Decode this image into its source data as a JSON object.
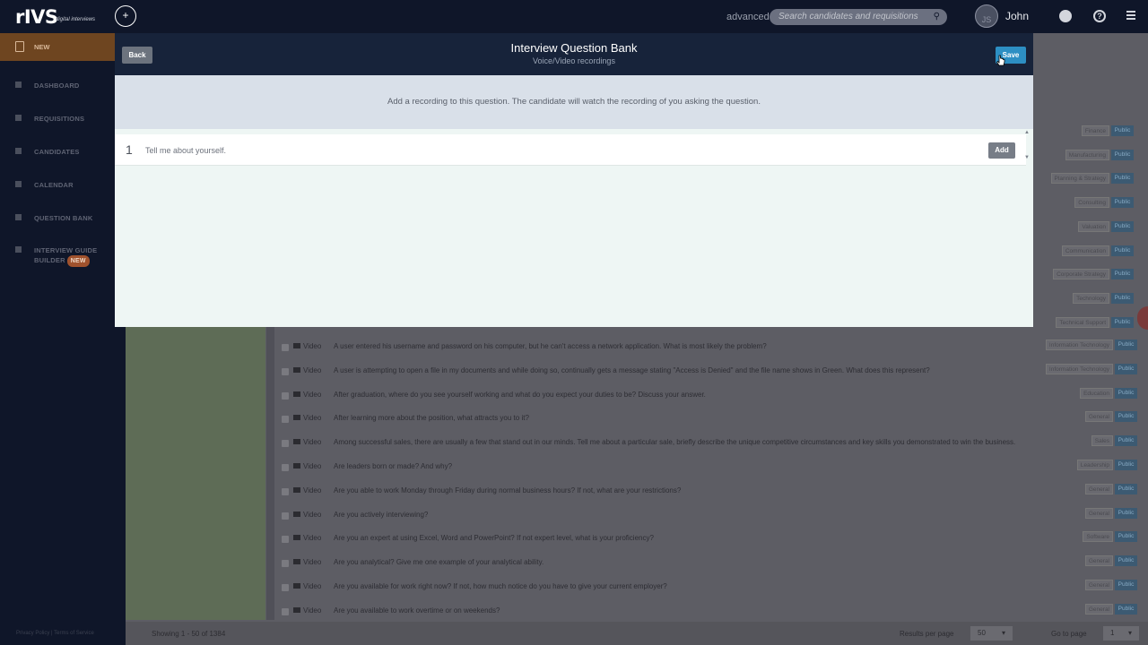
{
  "app": {
    "logo_text": "rIVS",
    "logo_sub": "digital interviews",
    "advanced_label": "advanced",
    "search_placeholder": "Search candidates and requisitions",
    "avatar_initials": "JS",
    "user_name": "John"
  },
  "sidebar": {
    "new_label": "NEW",
    "items": [
      {
        "label": "DASHBOARD"
      },
      {
        "label": "REQUISITIONS"
      },
      {
        "label": "CANDIDATES"
      },
      {
        "label": "CALENDAR"
      },
      {
        "label": "QUESTION BANK"
      },
      {
        "label": "INTERVIEW GUIDE BUILDER",
        "badge": "NEW"
      }
    ],
    "footer": "Privacy Policy | Terms of Service"
  },
  "modal": {
    "back_label": "Back",
    "title": "Interview Question Bank",
    "subtitle": "Voice/Video recordings",
    "save_label": "Save",
    "instruction": "Add a recording to this question. The candidate will watch the recording of you asking the question.",
    "question": {
      "number": "1",
      "text": "Tell me about yourself.",
      "add_label": "Add"
    }
  },
  "background_list": {
    "categories_above": [
      "Finance",
      "Manufacturing",
      "Planning & Strategy",
      "Consulting",
      "Valuation",
      "Communication",
      "Corporate Strategy",
      "Technology",
      "Technical Support"
    ],
    "public_label": "Public",
    "rows": [
      {
        "type": "Video",
        "text": "A user entered his username and password on his computer, but he can't access a network application. What is most likely the problem?",
        "category": "Information Technology"
      },
      {
        "type": "Video",
        "text": "A user is attempting to open a file in my documents and while doing so, continually gets a message stating \"Access is Denied\" and the file name shows in Green. What does this represent?",
        "category": "Information Technology"
      },
      {
        "type": "Video",
        "text": "After graduation, where do you see yourself working and what do you expect your duties to be? Discuss your answer.",
        "category": "Education"
      },
      {
        "type": "Video",
        "text": "After learning more about the position, what attracts you to it?",
        "category": "General"
      },
      {
        "type": "Video",
        "text": "Among successful sales, there are usually a few that stand out in our minds. Tell me about a particular sale, briefly describe the unique competitive circumstances and key skills you demonstrated to win the business.",
        "category": "Sales"
      },
      {
        "type": "Video",
        "text": "Are leaders born or made? And why?",
        "category": "Leadership"
      },
      {
        "type": "Video",
        "text": "Are you able to work Monday through Friday during normal business hours? If not, what are your restrictions?",
        "category": "General"
      },
      {
        "type": "Video",
        "text": "Are you actively interviewing?",
        "category": "General"
      },
      {
        "type": "Video",
        "text": "Are you an expert at using Excel, Word and PowerPoint? If not expert level, what is your proficiency?",
        "category": "Software"
      },
      {
        "type": "Video",
        "text": "Are you analytical? Give me one example of your analytical ability.",
        "category": "General"
      },
      {
        "type": "Video",
        "text": "Are you available for work right now? If not, how much notice do you have to give your current employer?",
        "category": "General"
      },
      {
        "type": "Video",
        "text": "Are you available to work overtime or on weekends?",
        "category": "General"
      }
    ]
  },
  "bottom_bar": {
    "showing": "Showing 1 - 50 of 1384",
    "results_per_page_label": "Results per page",
    "results_per_page_value": "50",
    "goto_label": "Go to page",
    "goto_value": "1"
  }
}
